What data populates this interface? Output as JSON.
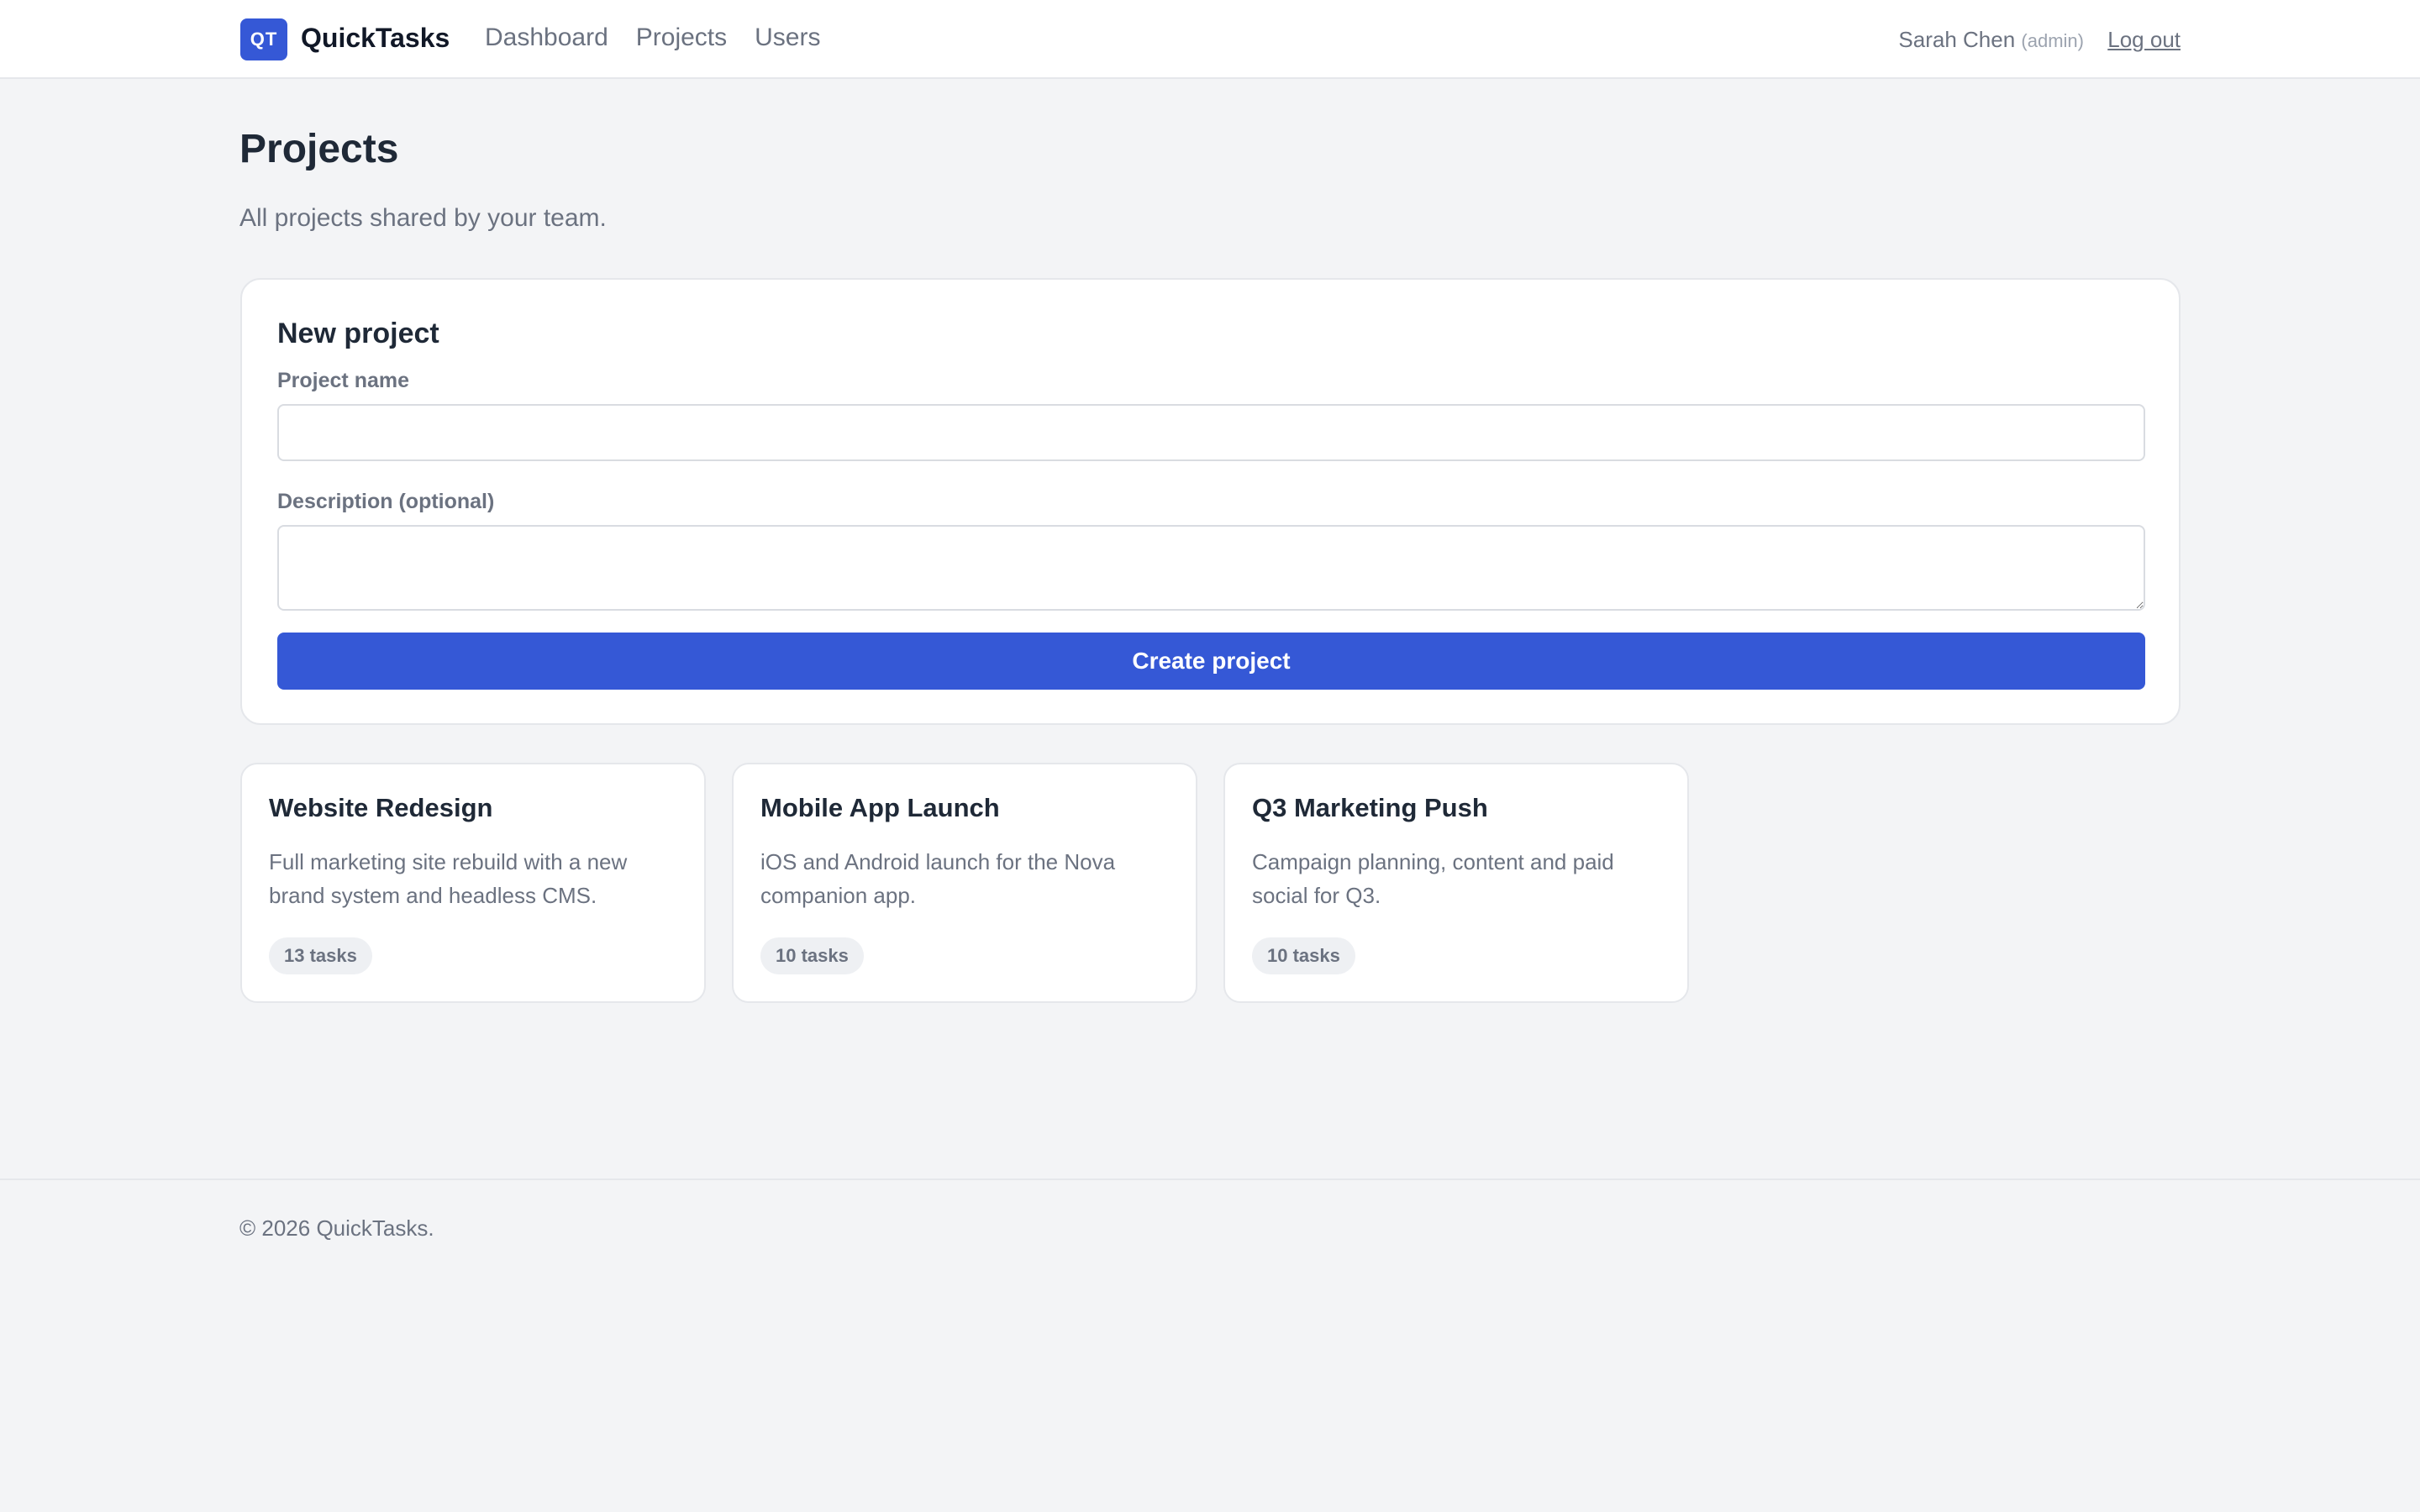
{
  "header": {
    "logo_text": "QT",
    "brand": "QuickTasks",
    "nav": [
      "Dashboard",
      "Projects",
      "Users"
    ],
    "user_name": "Sarah Chen",
    "user_role": "(admin)",
    "logout": "Log out"
  },
  "page": {
    "title": "Projects",
    "subtitle": "All projects shared by your team."
  },
  "form": {
    "title": "New project",
    "name_label": "Project name",
    "name_value": "",
    "description_label": "Description (optional)",
    "description_value": "",
    "submit_label": "Create project"
  },
  "projects": [
    {
      "name": "Website Redesign",
      "description": "Full marketing site rebuild with a new brand system and headless CMS.",
      "tasks": "13 tasks"
    },
    {
      "name": "Mobile App Launch",
      "description": "iOS and Android launch for the Nova companion app.",
      "tasks": "10 tasks"
    },
    {
      "name": "Q3 Marketing Push",
      "description": "Campaign planning, content and paid social for Q3.",
      "tasks": "10 tasks"
    }
  ],
  "footer": {
    "text": "© 2026 QuickTasks."
  },
  "colors": {
    "accent": "#3558d6",
    "background": "#f3f4f6",
    "muted_text": "#6b7280"
  }
}
